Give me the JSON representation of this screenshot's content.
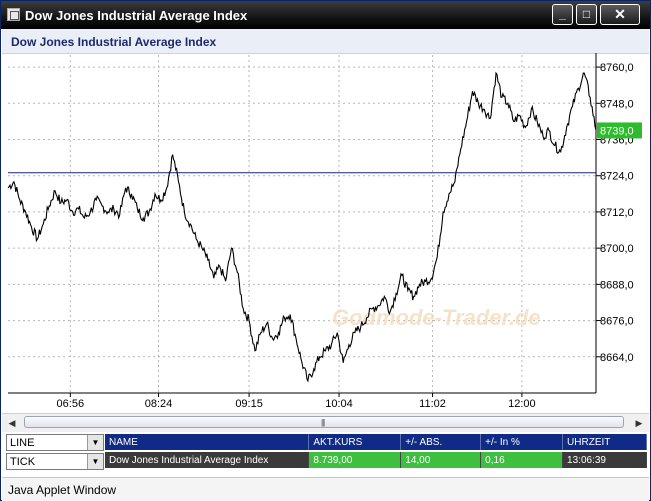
{
  "window": {
    "title": "Dow Jones Industrial Average Index",
    "minimize_glyph": "_",
    "maximize_glyph": "□",
    "close_glyph": "✕",
    "icon": "applet-window-icon"
  },
  "chart_header": {
    "title": "Dow Jones Industrial Average Index"
  },
  "chart_data": {
    "type": "line",
    "title": "Dow Jones Industrial Average Index",
    "xlabel": "",
    "ylabel": "",
    "ylim": [
      8652,
      8764
    ],
    "y_ticks": [
      "8760,0",
      "8748,0",
      "8736,0",
      "8724,0",
      "8712,0",
      "8700,0",
      "8688,0",
      "8676,0",
      "8664,0"
    ],
    "y_tick_values": [
      8760,
      8748,
      8736,
      8724,
      8712,
      8700,
      8688,
      8676,
      8664
    ],
    "x_ticks": [
      "06:56",
      "08:24",
      "09:15",
      "10:04",
      "11:02",
      "12:00"
    ],
    "x_tick_positions": [
      0.106,
      0.256,
      0.41,
      0.563,
      0.722,
      0.874
    ],
    "reference_line": 8725,
    "current_value_label": "8739,0",
    "current_value": 8739,
    "grid": true,
    "legend": "none",
    "watermark": "Godmode-Trader.de",
    "colors": {
      "line": "#000000",
      "reference": "#1a237e",
      "current_badge": "#2ebc2e",
      "grid": "#b8b8b8"
    },
    "series": [
      {
        "x": [
          0.0,
          0.01,
          0.02,
          0.03,
          0.04,
          0.05,
          0.06,
          0.07,
          0.08,
          0.09,
          0.1,
          0.11,
          0.12,
          0.13,
          0.14,
          0.15,
          0.16,
          0.17,
          0.18,
          0.19,
          0.2,
          0.21,
          0.22,
          0.23,
          0.24,
          0.25,
          0.26,
          0.27,
          0.28,
          0.29,
          0.3,
          0.31,
          0.32,
          0.33,
          0.34,
          0.35,
          0.36,
          0.37,
          0.38,
          0.39,
          0.4,
          0.41,
          0.42,
          0.43,
          0.44,
          0.45,
          0.46,
          0.47,
          0.48,
          0.49,
          0.5,
          0.51,
          0.52,
          0.53,
          0.54,
          0.55,
          0.56,
          0.57,
          0.58,
          0.59,
          0.6,
          0.61,
          0.62,
          0.63,
          0.64,
          0.65,
          0.66,
          0.67,
          0.68,
          0.69,
          0.7,
          0.71,
          0.72,
          0.73,
          0.74,
          0.75,
          0.76,
          0.77,
          0.78,
          0.79,
          0.8,
          0.81,
          0.82,
          0.83,
          0.84,
          0.85,
          0.86,
          0.87,
          0.88,
          0.89,
          0.9,
          0.91,
          0.92,
          0.93,
          0.94,
          0.95,
          0.96,
          0.97,
          0.98,
          0.99,
          1.0
        ],
        "values": [
          8720,
          8722,
          8716,
          8712,
          8707,
          8703,
          8708,
          8714,
          8719,
          8715,
          8716,
          8712,
          8713,
          8710,
          8712,
          8716,
          8714,
          8712,
          8713,
          8711,
          8720,
          8718,
          8713,
          8710,
          8712,
          8718,
          8716,
          8720,
          8731,
          8722,
          8712,
          8708,
          8703,
          8700,
          8696,
          8690,
          8694,
          8689,
          8700,
          8692,
          8680,
          8676,
          8666,
          8672,
          8675,
          8670,
          8672,
          8677,
          8678,
          8670,
          8662,
          8656,
          8660,
          8664,
          8666,
          8668,
          8672,
          8662,
          8668,
          8672,
          8674,
          8677,
          8680,
          8681,
          8684,
          8679,
          8685,
          8691,
          8686,
          8684,
          8688,
          8689,
          8690,
          8697,
          8712,
          8718,
          8722,
          8733,
          8742,
          8752,
          8748,
          8746,
          8743,
          8758,
          8750,
          8748,
          8742,
          8744,
          8740,
          8746,
          8742,
          8737,
          8739,
          8734,
          8732,
          8740,
          8747,
          8753,
          8758,
          8750,
          8739
        ]
      }
    ]
  },
  "scrollbar": {
    "left_arrow": "◀",
    "right_arrow": "▶",
    "grip": "|||"
  },
  "controls": {
    "chart_type_select": "LINE",
    "interval_select": "TICK",
    "dropdown_glyph": "▼"
  },
  "quote_table": {
    "headers": [
      "NAME",
      "AKT.KURS",
      "+/- ABS.",
      "+/- In %",
      "UHRZEIT"
    ],
    "row": [
      "Dow Jones Industrial Average Index",
      "8.739,00",
      "14,00",
      "0,16",
      "13:06:39"
    ]
  },
  "status_bar": {
    "text": "Java Applet Window"
  }
}
